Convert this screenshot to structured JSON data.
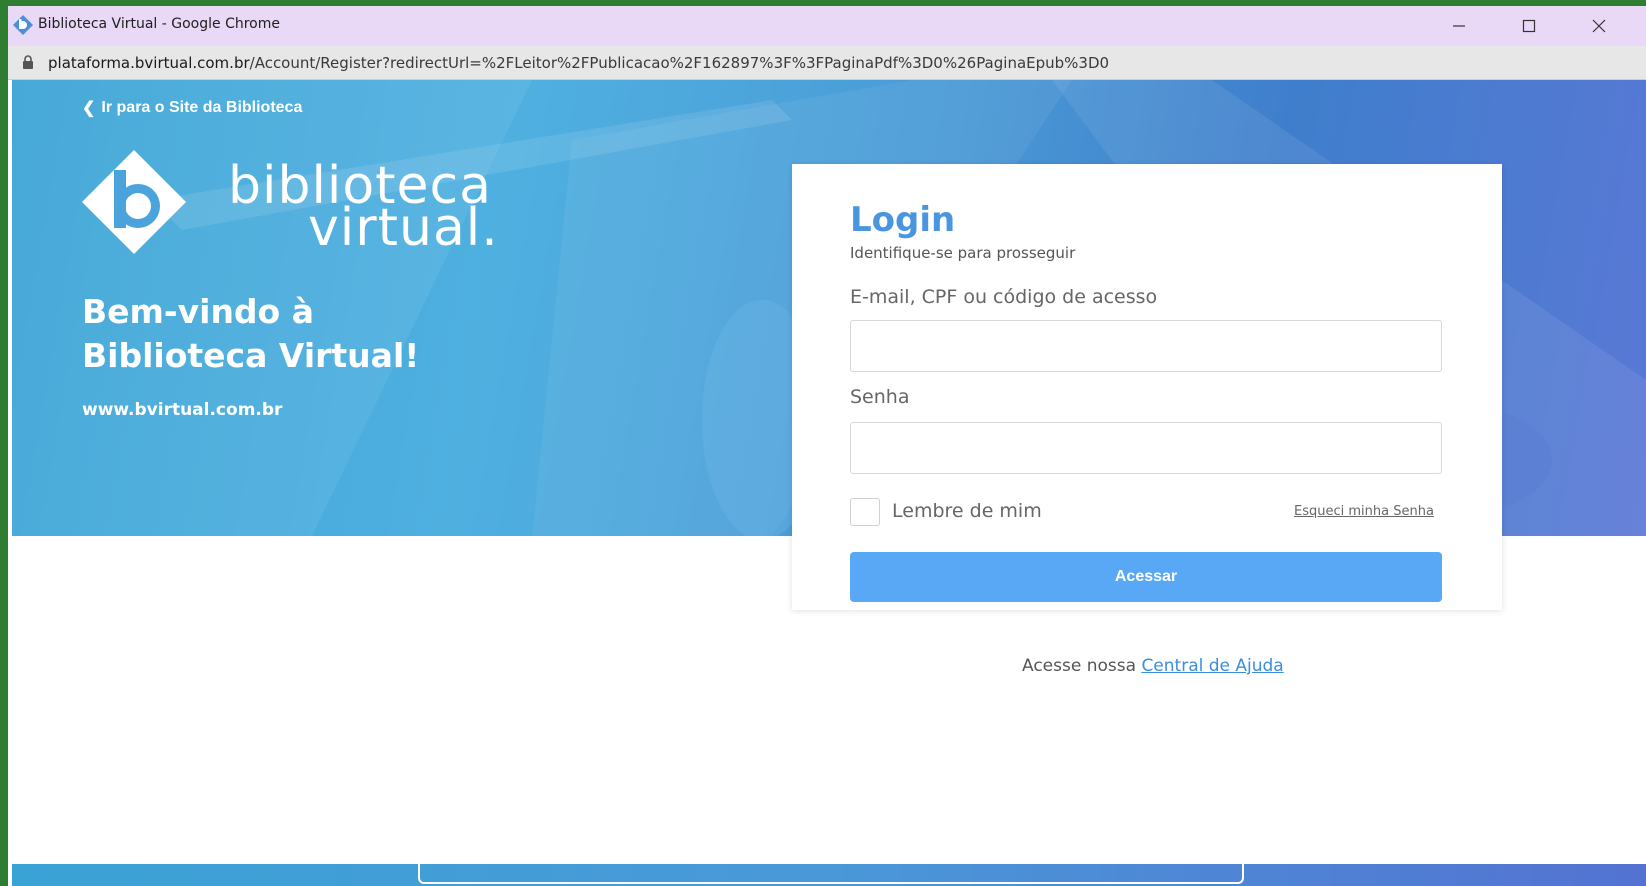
{
  "browser": {
    "window_title": "Biblioteca Virtual - Google Chrome",
    "url_host": "plataforma.bvirtual.com.br",
    "url_path": "/Account/Register?redirectUrl=%2FLeitor%2FPublicacao%2F162897%3F%3FPaginaPdf%3D0%26PaginaEpub%3D0",
    "minimize_glyph": "—",
    "maximize_glyph": "☐",
    "close_glyph": "✕"
  },
  "hero": {
    "back_link": "Ir para o Site da Biblioteca",
    "logo_line1": "biblioteca",
    "logo_line2": "virtual.",
    "welcome_line1": "Bem-vindo à",
    "welcome_line2": "Biblioteca Virtual!",
    "site_url": "www.bvirtual.com.br"
  },
  "login": {
    "title": "Login",
    "subtitle": "Identifique-se para prosseguir",
    "email_label": "E-mail, CPF ou código de acesso",
    "email_value": "",
    "password_label": "Senha",
    "password_value": "",
    "remember_label": "Lembre de mim",
    "remember_checked": false,
    "forgot_link": "Esqueci minha Senha",
    "submit_label": "Acessar"
  },
  "help": {
    "prefix": "Acesse nossa",
    "link": "Central de Ajuda"
  },
  "colors": {
    "accent": "#4a95e0",
    "button": "#59a8f5",
    "titlebar": "#ead8f7",
    "hero_start": "#3aa3d6",
    "hero_end": "#5a78d6"
  },
  "icons": {
    "app": "bvirtual-logo-icon",
    "lock": "lock-icon",
    "back": "chevron-left-icon"
  }
}
